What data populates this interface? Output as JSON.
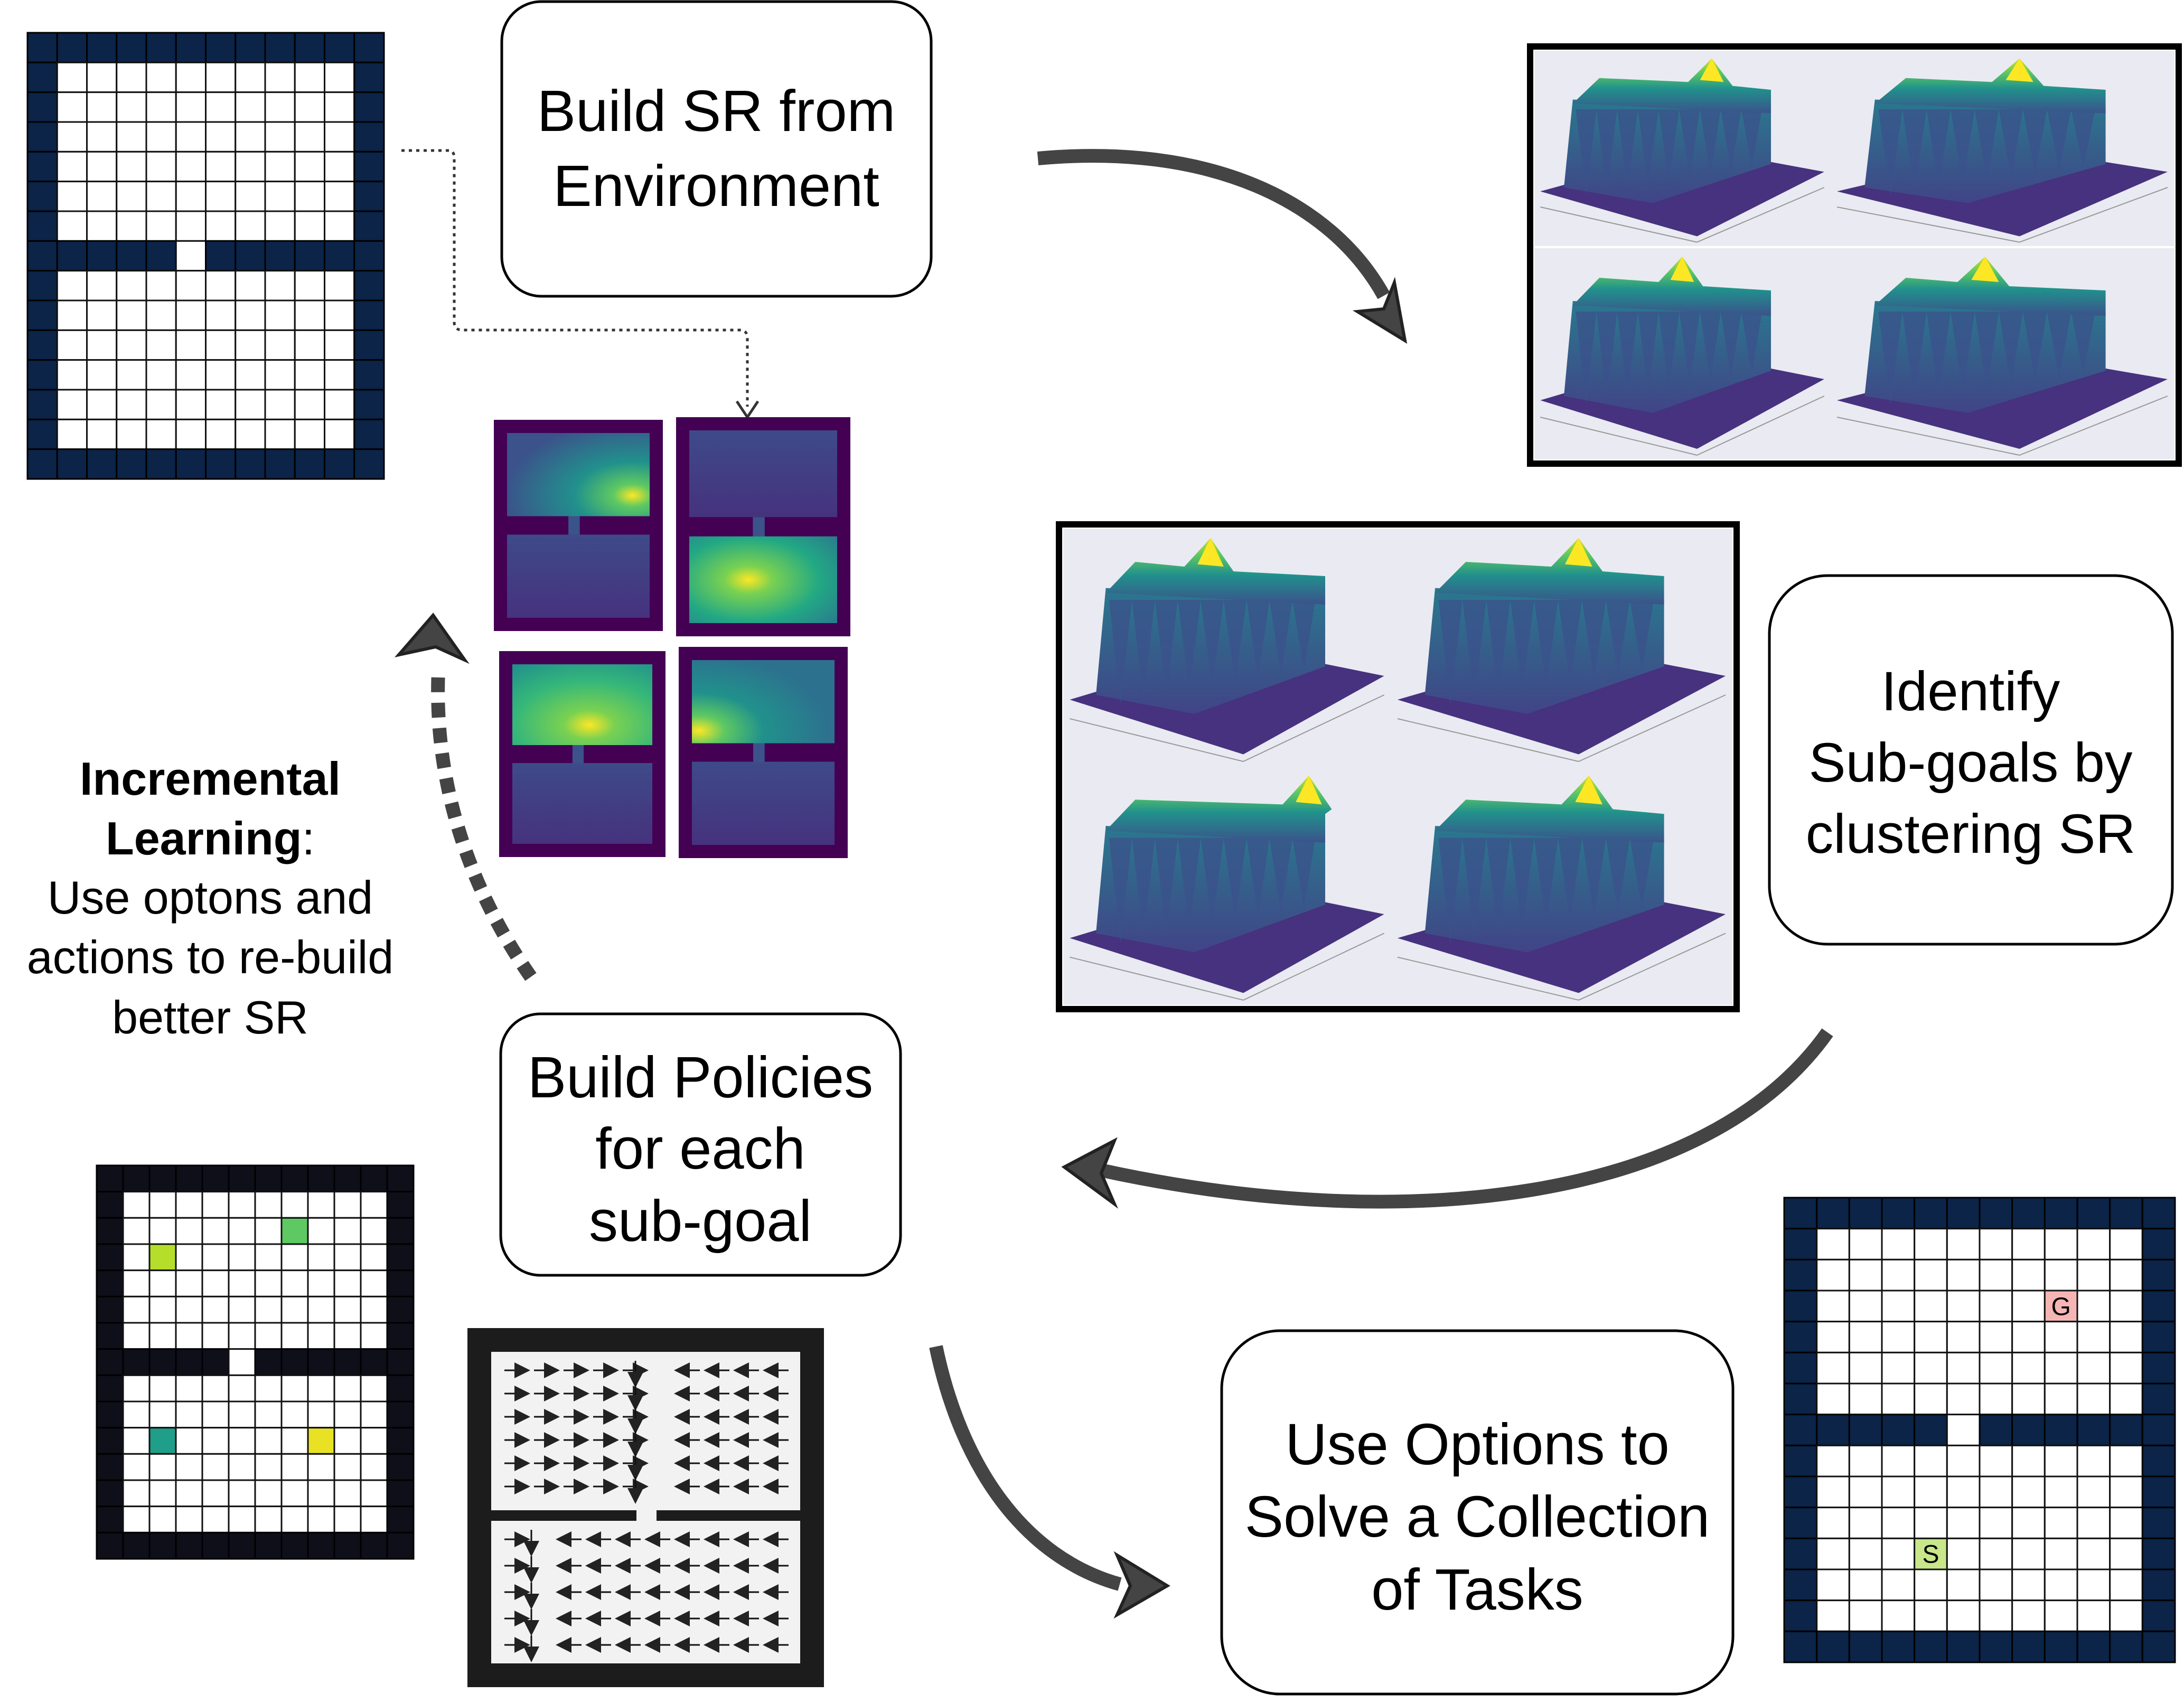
{
  "boxes": {
    "build_sr": [
      "Build SR from",
      "Environment"
    ],
    "identify": [
      "Identify",
      "Sub-goals by",
      "clustering SR"
    ],
    "policies": [
      "Build Policies",
      "for each",
      "sub-goal"
    ],
    "options": [
      "Use Options to",
      "Solve a Collection",
      "of Tasks"
    ]
  },
  "incremental": {
    "title_1": "Incremental",
    "title_2": "Learning",
    "colon": ":",
    "lines": [
      "Use optons and",
      "actions to re-build",
      "better SR"
    ]
  },
  "task_grid": {
    "goal": "G",
    "start": "S"
  },
  "colors": {
    "wall_navy": "#0b2448",
    "wall_black": "#0f0f1a",
    "arrow": "#444444",
    "viridis_dark": "#440154",
    "viridis_yellow": "#fde725",
    "goal_cell": "#f5b5b5",
    "start_cell": "#c8e68a"
  }
}
